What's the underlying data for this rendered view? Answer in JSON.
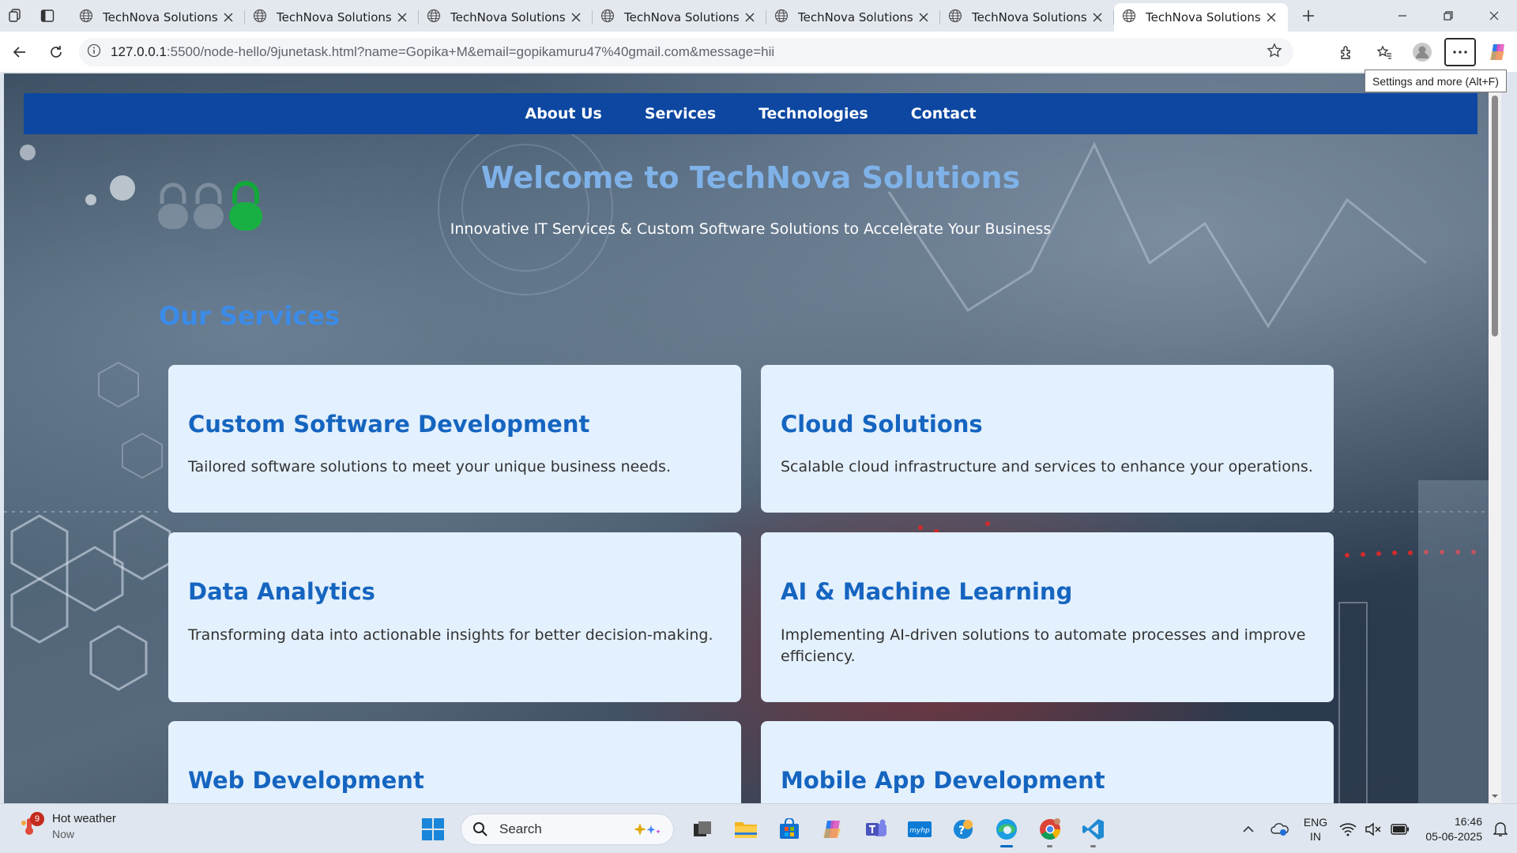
{
  "browser": {
    "tabs": [
      {
        "title": "TechNova Solutions",
        "active": false
      },
      {
        "title": "TechNova Solutions",
        "active": false
      },
      {
        "title": "TechNova Solutions",
        "active": false
      },
      {
        "title": "TechNova Solutions",
        "active": false
      },
      {
        "title": "TechNova Solutions",
        "active": false
      },
      {
        "title": "TechNova Solutions",
        "active": false
      },
      {
        "title": "TechNova Solutions",
        "active": true
      }
    ],
    "url_host": "127.0.0.1",
    "url_rest": ":5500/node-hello/9junetask.html?name=Gopika+M&email=gopikamuru47%40gmail.com&message=hii",
    "tooltip": "Settings and more (Alt+F)"
  },
  "page": {
    "nav": [
      "About Us",
      "Services",
      "Technologies",
      "Contact"
    ],
    "hero_title": "Welcome to TechNova Solutions",
    "hero_subtitle": "Innovative IT Services & Custom Software Solutions to Accelerate Your Business",
    "section_title": "Our Services",
    "services": [
      {
        "title": "Custom Software Development",
        "desc": "Tailored software solutions to meet your unique business needs."
      },
      {
        "title": "Cloud Solutions",
        "desc": "Scalable cloud infrastructure and services to enhance your operations."
      },
      {
        "title": "Data Analytics",
        "desc": "Transforming data into actionable insights for better decision-making."
      },
      {
        "title": "AI & Machine Learning",
        "desc": "Implementing AI-driven solutions to automate processes and improve efficiency."
      },
      {
        "title": "Web Development",
        "desc": ""
      },
      {
        "title": "Mobile App Development",
        "desc": ""
      }
    ],
    "colors": {
      "nav_bg": "#0d47a1",
      "hero_title": "#7fb2e8",
      "section_title": "#3b8be8",
      "card_bg": "#e3f0fd",
      "card_title": "#1565c0"
    }
  },
  "taskbar": {
    "weather_title": "Hot weather",
    "weather_sub": "Now",
    "weather_badge": "9",
    "search_placeholder": "Search",
    "lang_line1": "ENG",
    "lang_line2": "IN",
    "time": "16:46",
    "date": "05-06-2025"
  }
}
